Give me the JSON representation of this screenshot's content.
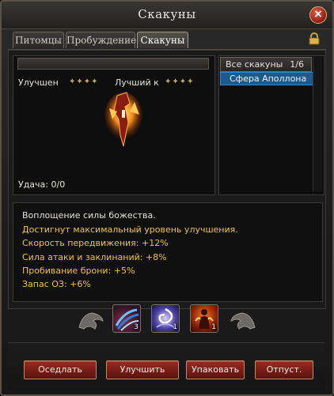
{
  "window": {
    "title": "Скакуны"
  },
  "tabs": [
    {
      "label": "Питомцы",
      "active": false
    },
    {
      "label": "Пробуждение",
      "active": false
    },
    {
      "label": "Скакуны",
      "active": true
    }
  ],
  "mount_view": {
    "name": "",
    "improved_label": "Улучшен",
    "improved_stars": 4,
    "best_label": "Лучший к",
    "best_stars": 4,
    "luck_label": "Удача: 0/0"
  },
  "mount_list": {
    "header": "Все скакуны",
    "count": "1/6",
    "items": [
      "Сфера Аполлона"
    ]
  },
  "description": {
    "intro": "Воплощение силы божества.",
    "max_level": "Достигнут максимальный уровень улучшения.",
    "stats": [
      "Скорость передвижения: +12%",
      "Сила атаки и заклинаний: +8%",
      "Пробивание брони: +5%",
      "Запас ОЗ: +6%"
    ],
    "colors": {
      "intro": "#e4e0da",
      "highlight": "#f0c431"
    }
  },
  "skills": [
    {
      "icon": "claw-strike-icon",
      "count": "3"
    },
    {
      "icon": "spirit-swirl-icon",
      "count": "1"
    },
    {
      "icon": "fire-warrior-icon",
      "count": "1"
    }
  ],
  "buttons": {
    "saddle": "Оседлать",
    "improve": "Улучшить",
    "pack": "Упаковать",
    "release": "Отпуст."
  },
  "icons": {
    "close": "close-icon",
    "lock": "lock-icon"
  }
}
